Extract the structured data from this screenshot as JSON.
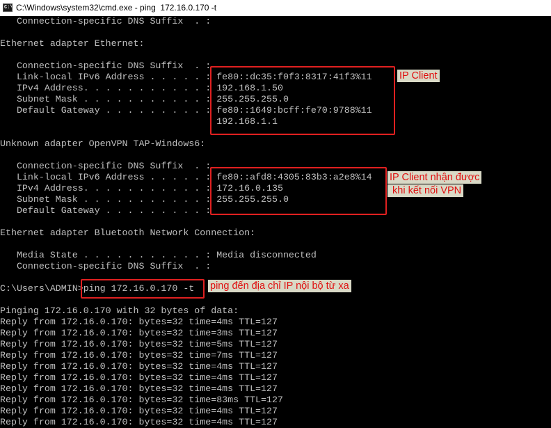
{
  "window": {
    "title": "C:\\Windows\\system32\\cmd.exe - ping  172.16.0.170 -t",
    "icon": "cmd-icon",
    "icon_text": "C:\\"
  },
  "console": {
    "lines": [
      "   Connection-specific DNS Suffix  . :",
      "",
      "Ethernet adapter Ethernet:",
      "",
      "   Connection-specific DNS Suffix  . :",
      "   Link-local IPv6 Address . . . . . : fe80::dc35:f0f3:8317:41f3%11",
      "   IPv4 Address. . . . . . . . . . . : 192.168.1.50",
      "   Subnet Mask . . . . . . . . . . . : 255.255.255.0",
      "   Default Gateway . . . . . . . . . : fe80::1649:bcff:fe70:9788%11",
      "                                       192.168.1.1",
      "",
      "Unknown adapter OpenVPN TAP-Windows6:",
      "",
      "   Connection-specific DNS Suffix  . :",
      "   Link-local IPv6 Address . . . . . : fe80::afd8:4305:83b3:a2e8%14",
      "   IPv4 Address. . . . . . . . . . . : 172.16.0.135",
      "   Subnet Mask . . . . . . . . . . . : 255.255.255.0",
      "   Default Gateway . . . . . . . . . :",
      "",
      "Ethernet adapter Bluetooth Network Connection:",
      "",
      "   Media State . . . . . . . . . . . : Media disconnected",
      "   Connection-specific DNS Suffix  . :",
      "",
      "C:\\Users\\ADMIN>ping 172.16.0.170 -t",
      "",
      "Pinging 172.16.0.170 with 32 bytes of data:",
      "Reply from 172.16.0.170: bytes=32 time=4ms TTL=127",
      "Reply from 172.16.0.170: bytes=32 time=3ms TTL=127",
      "Reply from 172.16.0.170: bytes=32 time=5ms TTL=127",
      "Reply from 172.16.0.170: bytes=32 time=7ms TTL=127",
      "Reply from 172.16.0.170: bytes=32 time=4ms TTL=127",
      "Reply from 172.16.0.170: bytes=32 time=4ms TTL=127",
      "Reply from 172.16.0.170: bytes=32 time=4ms TTL=127",
      "Reply from 172.16.0.170: bytes=32 time=83ms TTL=127",
      "Reply from 172.16.0.170: bytes=32 time=4ms TTL=127",
      "Reply from 172.16.0.170: bytes=32 time=4ms TTL=127"
    ]
  },
  "annotations": {
    "ip_client": "IP Client",
    "ip_vpn_line1": "IP Client nhận được",
    "ip_vpn_line2": " khi kết nối VPN",
    "ping_note": "ping đến địa chỉ IP nội bộ từ xa"
  },
  "colors": {
    "console_bg": "#000000",
    "console_text": "#c0c0c0",
    "highlight_border": "#e02020",
    "note_bg": "#d9d9c6",
    "note_text": "#e01010"
  }
}
